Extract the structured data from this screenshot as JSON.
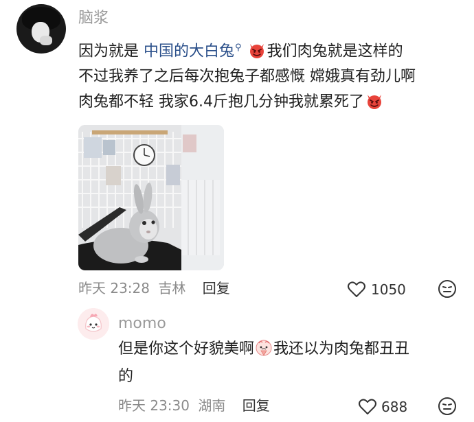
{
  "comment": {
    "username": "脑浆",
    "text_before_link": "因为就是",
    "link_text": "中国的大白兔",
    "line1_after": "我们肉兔就是这样的",
    "line2": "不过我养了之后每次抱兔子都感慨 嫦娥真有劲儿啊",
    "line3": "肉兔都不轻 我家6.4斤抱几分钟我就累死了",
    "time": "昨天 23:28",
    "location": "吉林",
    "reply_label": "回复",
    "likes": "1050",
    "icons": [
      "search-icon",
      "devil-emoji",
      "heart-icon",
      "dislike-face-icon"
    ]
  },
  "reply": {
    "username": "momo",
    "line1": "但是你这个好貌美啊",
    "line1_after": "我还以为肉兔都丑丑",
    "line2": "的",
    "time": "昨天 23:30",
    "location": "湖南",
    "reply_label": "回复",
    "likes": "688",
    "icons": [
      "pleading-emoji",
      "heart-icon",
      "dislike-face-icon"
    ]
  },
  "colors": {
    "username": "#9a9a9a",
    "link": "#2a4f8a",
    "meta": "#8a8a8a",
    "devil_emoji": "#e8433a"
  }
}
